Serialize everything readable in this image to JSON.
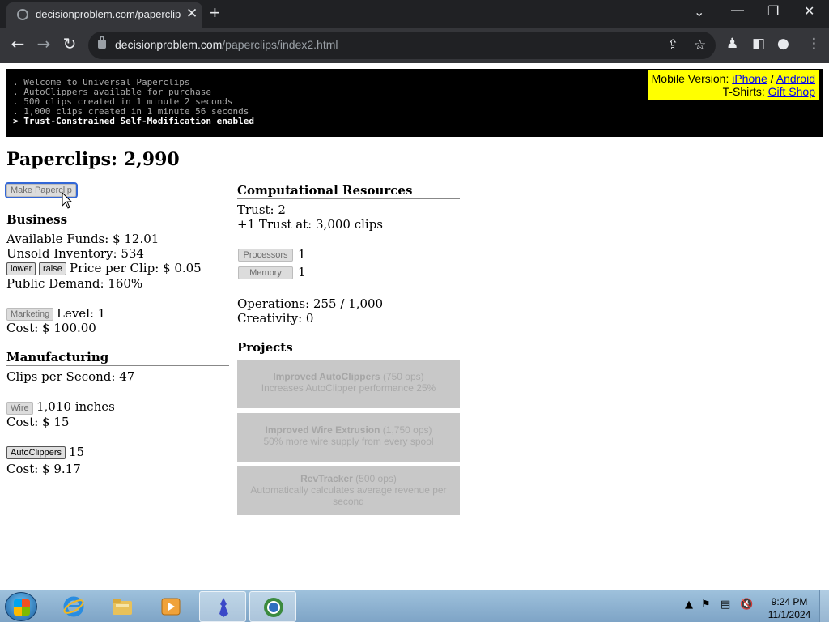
{
  "browser": {
    "tab_title": "decisionproblem.com/paperclips/",
    "url_domain": "decisionproblem.com",
    "url_path": "/paperclips/index2.html"
  },
  "console": {
    "lines": [
      ". Welcome to Universal Paperclips",
      ". AutoClippers available for purchase",
      ". 500 clips created in 1 minute 2 seconds",
      ". 1,000 clips created in 1 minute 56 seconds",
      "> Trust-Constrained Self-Modification enabled"
    ]
  },
  "promo": {
    "mobile_label": "Mobile Version:",
    "iphone": "iPhone",
    "sep": "/",
    "android": "Android",
    "tshirts_label": "T-Shirts:",
    "gift_shop": "Gift Shop"
  },
  "game": {
    "paperclips_title": "Paperclips: 2,990",
    "make_button": "Make Paperclip",
    "business": {
      "heading": "Business",
      "funds": "Available Funds: $ 12.01",
      "inventory": "Unsold Inventory: 534",
      "lower": "lower",
      "raise": "raise",
      "price": "Price per Clip: $ 0.05",
      "demand": "Public Demand: 160%",
      "marketing_button": "Marketing",
      "marketing_level": "Level: 1",
      "marketing_cost": "Cost: $ 100.00"
    },
    "manufacturing": {
      "heading": "Manufacturing",
      "clips_per_second": "Clips per Second: 47",
      "wire_button": "Wire",
      "wire_amount": "1,010 inches",
      "wire_cost": "Cost: $ 15",
      "autoclippers_button": "AutoClippers",
      "autoclippers_count": "15",
      "autoclippers_cost": "Cost: $ 9.17"
    },
    "computational": {
      "heading": "Computational Resources",
      "trust": "Trust: 2",
      "next_trust": "+1 Trust at: 3,000 clips",
      "processors_button": "Processors",
      "processors_value": "1",
      "memory_button": "Memory",
      "memory_value": "1",
      "operations": "Operations: 255 / 1,000",
      "creativity": "Creativity: 0"
    },
    "projects": {
      "heading": "Projects",
      "items": [
        {
          "title": "Improved AutoClippers",
          "cost": "(750 ops)",
          "desc": "Increases AutoClipper performance 25%"
        },
        {
          "title": "Improved Wire Extrusion",
          "cost": "(1,750 ops)",
          "desc": "50% more wire supply from every spool"
        },
        {
          "title": "RevTracker",
          "cost": "(500 ops)",
          "desc": "Automatically calculates average revenue per second"
        }
      ]
    }
  },
  "taskbar": {
    "time": "9:24 PM",
    "date": "11/1/2024"
  }
}
